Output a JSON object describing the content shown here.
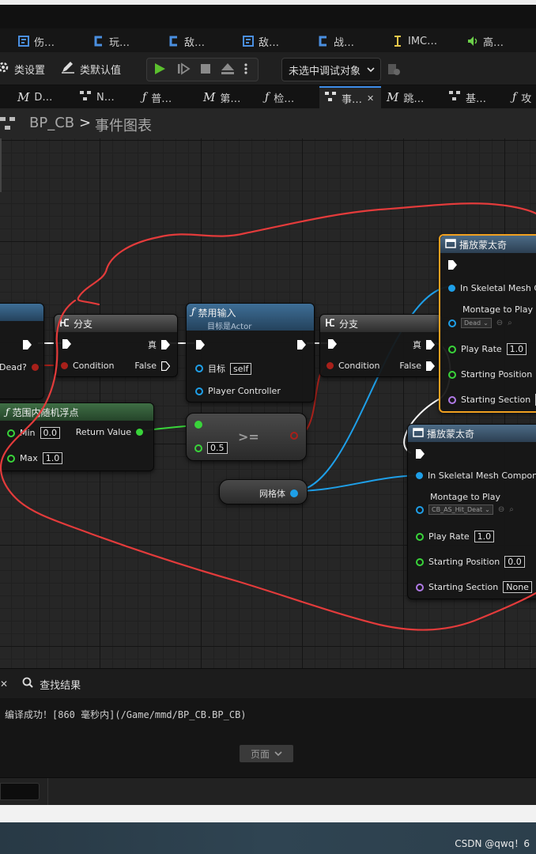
{
  "asset_tabs": [
    {
      "label": "伤…",
      "icon": "blueprint-struct-icon",
      "color": "#4a8fe0"
    },
    {
      "label": "玩…",
      "icon": "blueprint-class-icon",
      "color": "#4a8fe0"
    },
    {
      "label": "敌…",
      "icon": "blueprint-class-icon",
      "color": "#4a8fe0"
    },
    {
      "label": "敌…",
      "icon": "blueprint-struct-icon",
      "color": "#4a8fe0"
    },
    {
      "label": "战…",
      "icon": "blueprint-class-icon",
      "color": "#4a8fe0"
    },
    {
      "label": "IMC…",
      "icon": "input-mapping-icon",
      "color": "#e8c84a"
    },
    {
      "label": "高…",
      "icon": "sound-icon",
      "color": "#6ccf4a"
    }
  ],
  "toolbar": {
    "class_settings": "类设置",
    "class_defaults": "类默认值",
    "debug_target": "未选中调试对象"
  },
  "doc_tabs": [
    {
      "label": "D…",
      "kind": "M"
    },
    {
      "label": "N…",
      "kind": "graph"
    },
    {
      "label": "普…",
      "kind": "f"
    },
    {
      "label": "第…",
      "kind": "M"
    },
    {
      "label": "检…",
      "kind": "f"
    },
    {
      "label": "事…",
      "kind": "graph",
      "active": true
    },
    {
      "label": "跳…",
      "kind": "M"
    },
    {
      "label": "基…",
      "kind": "graph"
    },
    {
      "label": "攻",
      "kind": "f"
    }
  ],
  "breadcrumb": {
    "blueprint": "BP_CB",
    "separator": ">",
    "graph": "事件图表"
  },
  "nodes": {
    "left_partial": {
      "pin": "Dead?"
    },
    "branch1": {
      "title": "分支",
      "condition": "Condition",
      "true_label": "真",
      "false_label": "False"
    },
    "disable_input": {
      "title": "禁用输入",
      "subtitle": "目标是Actor",
      "target_label": "目标",
      "target_value": "self",
      "player_controller": "Player Controller"
    },
    "branch2": {
      "title": "分支",
      "condition": "Condition",
      "true_label": "真",
      "false_label": "False"
    },
    "random_float": {
      "title": "范围内随机浮点",
      "min_label": "Min",
      "min_value": "0.0",
      "max_label": "Max",
      "max_value": "1.0",
      "return_label": "Return Value"
    },
    "compare": {
      "op": ">=",
      "b_value": "0.5"
    },
    "mesh_var": {
      "label": "网格体"
    },
    "montage1": {
      "title": "播放蒙太奇",
      "in_mesh": "In Skeletal Mesh C",
      "montage_label": "Montage to Play",
      "montage_value": "Dead",
      "play_rate_label": "Play Rate",
      "play_rate": "1.0",
      "start_pos_label": "Starting Position",
      "start_section_label": "Starting Section"
    },
    "montage2": {
      "title": "播放蒙太奇",
      "in_mesh": "In Skeletal Mesh Compone",
      "montage_label": "Montage to Play",
      "montage_value": "CB_AS_Hit_Deat",
      "play_rate_label": "Play Rate",
      "play_rate": "1.0",
      "start_pos_label": "Starting Position",
      "start_pos": "0.0",
      "start_section_label": "Starting Section",
      "start_section": "None"
    }
  },
  "bottom": {
    "find_results": "查找结果",
    "log": "编译成功！[860 毫秒内](/Game/mmd/BP_CB.BP_CB)",
    "page_button": "页面"
  },
  "watermark": "CSDN @qwq！6",
  "colors": {
    "exec": "#ffffff",
    "bool": "#a8201a",
    "float": "#39d43a",
    "object": "#1e9fe8",
    "struct_or_name": "#b07ae6",
    "scribble": "#e33b3b",
    "selection": "#f0a020"
  }
}
